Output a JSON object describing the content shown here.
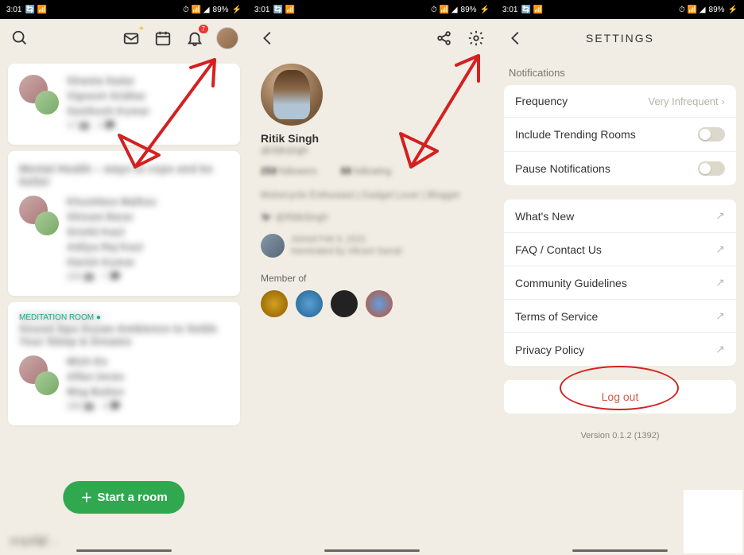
{
  "status": {
    "time": "3:01",
    "battery": "89%",
    "indicators_left": "🔄 📶",
    "indicators_right": "⏱ 📶 ◢"
  },
  "screen1": {
    "bell_badge": "7",
    "start_room": "Start a room",
    "cards": [
      {
        "names": [
          "Shweta Sadar",
          "Vignesh Sridhar",
          "Santhosh Kumar"
        ],
        "meta": "17 👥 · 3 💬"
      },
      {
        "title": "Mental Health – ways to cope and be better",
        "names": [
          "Khushboo Malhos",
          "Shivani Barar",
          "Srishti Kaul",
          "Aditya Raj Kaul",
          "Harish Kumar"
        ],
        "meta": "206 👥 · 7 💬"
      },
      {
        "eyebrow": "MEDITATION ROOM ●",
        "title": "Sound Spa Ocean Ambience to Settle Your Sleep & Dreams",
        "names": [
          "Minh Do",
          "Affan Imran",
          "Mog Button"
        ],
        "meta": "286 👥 · 3 💬"
      }
    ],
    "bottom_text": "ഓട്ടയിളി …"
  },
  "screen2": {
    "name": "Ritik Singh",
    "handle": "@ritiksingh",
    "followers_count": "258",
    "followers_label": "followers",
    "following_count": "88",
    "following_label": "following",
    "bio": "Motorcycle Enthusiast | Gadget Lover | Blogger",
    "twitter": "@RitikSingh",
    "joined": "Joined Feb 9, 2021",
    "nominated": "Nominated by Vikrant Samal",
    "member_of": "Member of"
  },
  "screen3": {
    "title": "SETTINGS",
    "notifications_label": "Notifications",
    "frequency_label": "Frequency",
    "frequency_value": "Very Infrequent",
    "trending_label": "Include Trending Rooms",
    "pause_label": "Pause Notifications",
    "links": {
      "whats_new": "What's New",
      "faq": "FAQ / Contact Us",
      "community": "Community Guidelines",
      "tos": "Terms of Service",
      "privacy": "Privacy Policy"
    },
    "logout": "Log out",
    "version": "Version 0.1.2 (1392)"
  }
}
